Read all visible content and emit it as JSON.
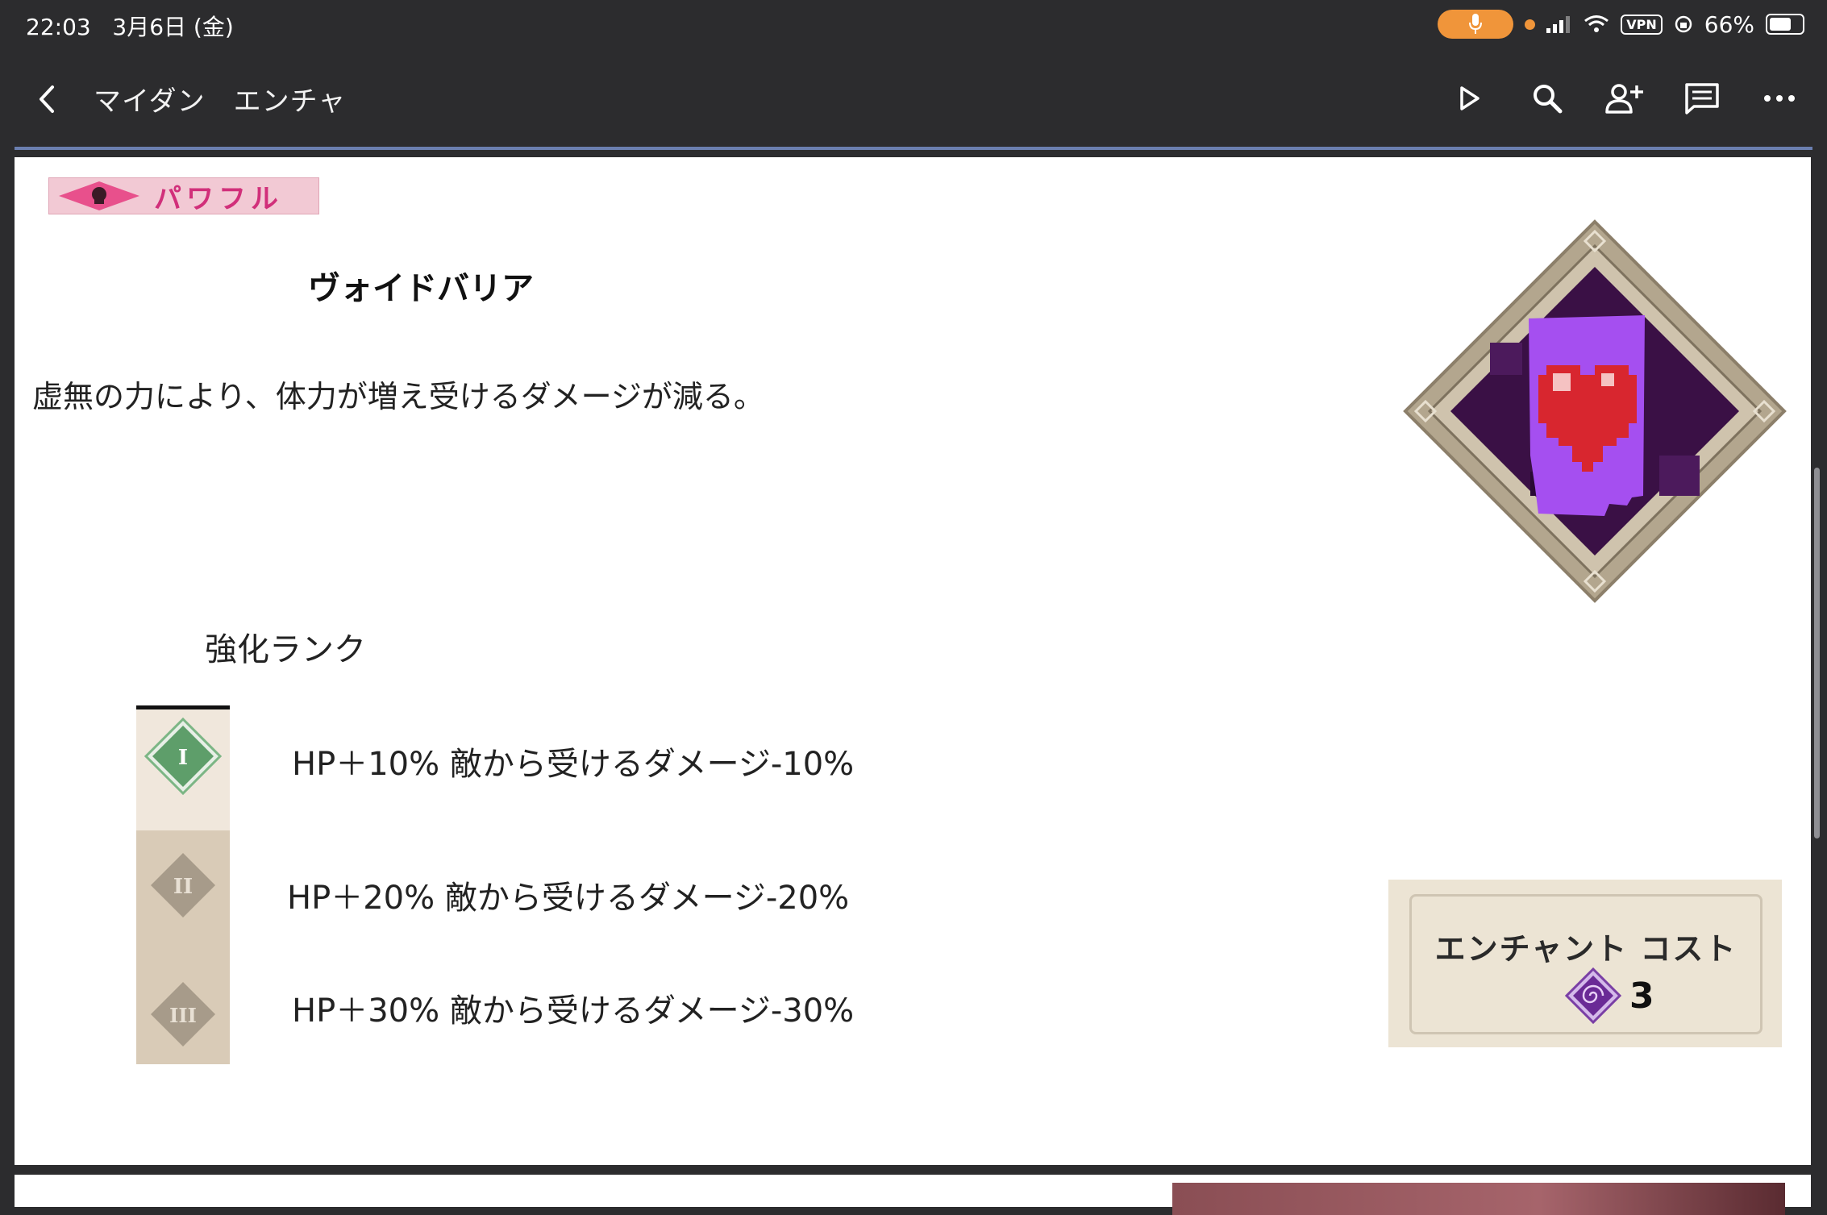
{
  "status_bar": {
    "time": "22:03",
    "date": "3月6日 (金)",
    "vpn": "VPN",
    "battery": "66%",
    "battery_level": 0.66
  },
  "toolbar": {
    "title": "マイダン　エンチャ",
    "icons": [
      "back-icon",
      "play-icon",
      "search-icon",
      "add-person-icon",
      "comment-icon",
      "more-icon"
    ]
  },
  "enchant": {
    "badge": "パワフル",
    "name": "ヴォイドバリア",
    "description": "虚無の力により、体力が増え受けるダメージが減る。",
    "rank_heading": "強化ランク",
    "ranks": [
      {
        "numeral": "I",
        "text": "HP＋10% 敵から受けるダメージ-10%"
      },
      {
        "numeral": "II",
        "text": "HP＋20% 敵から受けるダメージ-20%"
      },
      {
        "numeral": "III",
        "text": "HP＋30% 敵から受けるダメージ-30%"
      }
    ],
    "cost_label": "エンチャント コスト",
    "cost_value": "3"
  },
  "colors": {
    "accent_mic": "#f0953a",
    "badge_pink": "#d12f7a",
    "rank_green": "#5e9e6a",
    "rank_gray": "#a79b8a",
    "void_purple": "#9b3fe0"
  }
}
